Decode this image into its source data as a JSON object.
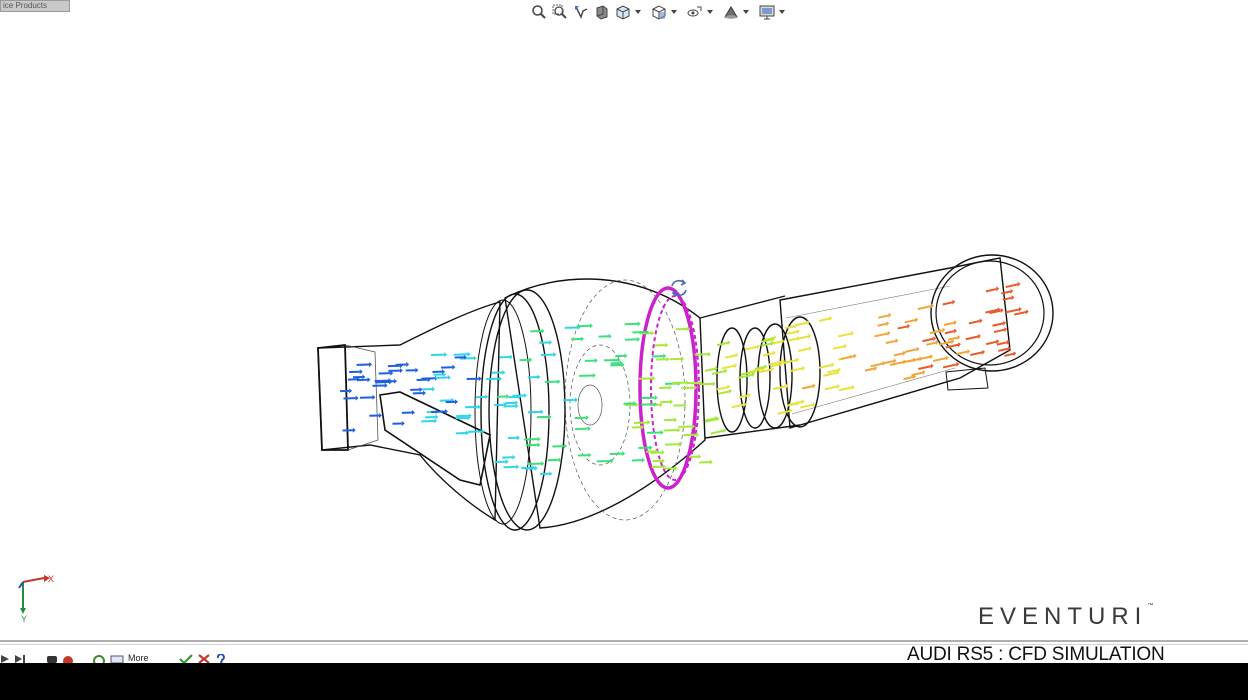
{
  "window": {
    "tag_label": "ice Products"
  },
  "toolbar": {
    "icons": [
      "zoom-to-fit-icon",
      "zoom-area-icon",
      "previous-view-icon",
      "section-view-icon",
      "view-orientation-icon",
      "display-style-icon",
      "hide-show-items-icon",
      "edit-appearance-icon",
      "apply-scene-icon",
      "view-settings-icon"
    ]
  },
  "viewport": {
    "triad": {
      "x_label": "X",
      "y_label": "Y"
    },
    "flow_colors": [
      "#1f5fe0",
      "#2fd6e8",
      "#3ce07a",
      "#a6e83a",
      "#e8e23a",
      "#f0a63a",
      "#e85a2a"
    ],
    "highlight_color": "#cc22cc"
  },
  "brand": {
    "logo_text": "EVENTURI",
    "trademark": "™"
  },
  "caption": {
    "subtitle": "AUDI RS5 : CFD SIMULATION"
  },
  "statusbar": {
    "more_label": "More"
  }
}
